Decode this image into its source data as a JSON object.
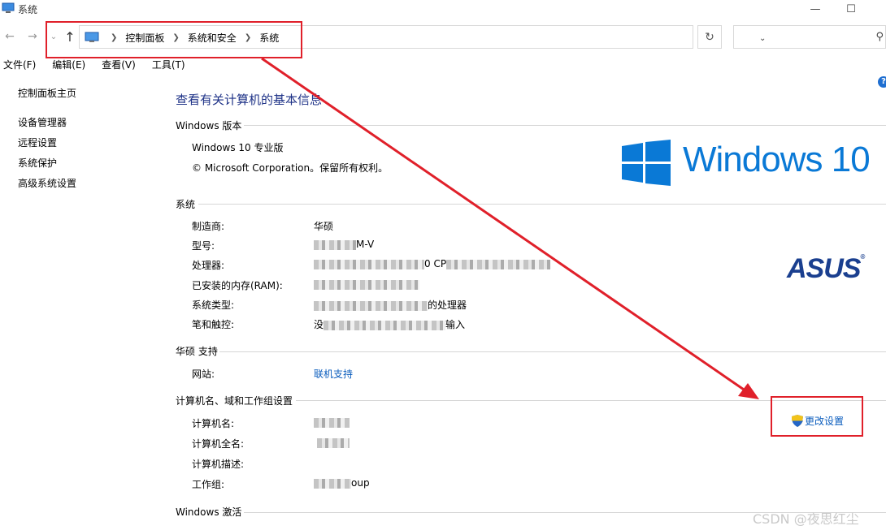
{
  "window": {
    "title": "系统",
    "minimize_glyph": "—",
    "maximize_glyph": "☐"
  },
  "nav": {
    "back_glyph": "←",
    "forward_glyph": "→",
    "recent_glyph": "⌄",
    "up_glyph": "↑",
    "breadcrumbs": [
      "控制面板",
      "系统和安全",
      "系统"
    ],
    "dropdown_glyph": "⌄",
    "refresh_glyph": "↻",
    "search_placeholder": ""
  },
  "menu": [
    "文件(F)",
    "编辑(E)",
    "查看(V)",
    "工具(T)"
  ],
  "help_glyph": "?",
  "sidebar": {
    "home": "控制面板主页",
    "items": [
      "设备管理器",
      "远程设置",
      "系统保护",
      "高级系统设置"
    ]
  },
  "main": {
    "title": "查看有关计算机的基本信息",
    "windows_edition": {
      "heading": "Windows 版本",
      "edition": "Windows 10 专业版",
      "copyright": "© Microsoft Corporation。保留所有权利。"
    },
    "logo_text": "Windows 10",
    "system": {
      "heading": "系统",
      "rows": [
        {
          "label": "制造商:",
          "value": "华硕",
          "tail": ""
        },
        {
          "label": "型号:",
          "value": "",
          "tail": "M-V"
        },
        {
          "label": "处理器:",
          "value": "",
          "tail": "0 CP"
        },
        {
          "label": "已安装的内存(RAM):",
          "value": "",
          "tail": ""
        },
        {
          "label": "系统类型:",
          "value": "",
          "tail": "的处理器"
        },
        {
          "label": "笔和触控:",
          "value": "没",
          "tail": "输入"
        }
      ]
    },
    "oem_logo": "ASUS",
    "support": {
      "heading": "华硕 支持",
      "label": "网站:",
      "link": "联机支持"
    },
    "computer": {
      "heading": "计算机名、域和工作组设置",
      "rows": [
        {
          "label": "计算机名:",
          "tail": ""
        },
        {
          "label": "计算机全名:",
          "tail": ""
        },
        {
          "label": "计算机描述:",
          "tail": ""
        },
        {
          "label": "工作组:",
          "tail": "oup"
        }
      ],
      "change_button": "更改设置"
    },
    "activation": {
      "heading": "Windows 激活"
    }
  },
  "watermark": "CSDN @夜思红尘",
  "colors": {
    "highlight": "#e0202a",
    "link": "#0a5cbd",
    "title": "#1e3287",
    "windows_blue": "#0a79d6"
  }
}
